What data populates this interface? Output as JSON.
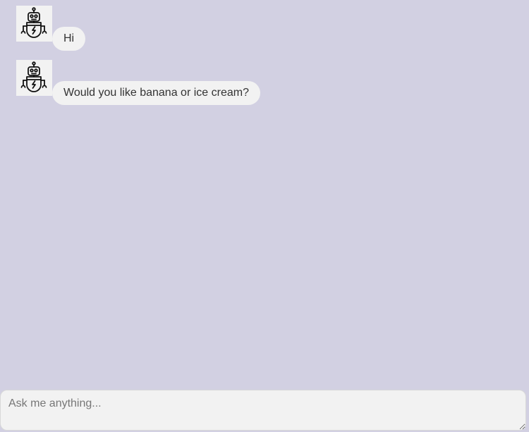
{
  "messages": [
    {
      "sender": "bot",
      "avatar_icon": "robot-icon",
      "text": "Hi"
    },
    {
      "sender": "bot",
      "avatar_icon": "robot-icon",
      "text": "Would you like banana or ice cream?"
    }
  ],
  "input": {
    "placeholder": "Ask me anything...",
    "value": ""
  },
  "colors": {
    "background": "#d2d0e2",
    "bubble": "#f2f2f2",
    "text": "#333333"
  }
}
